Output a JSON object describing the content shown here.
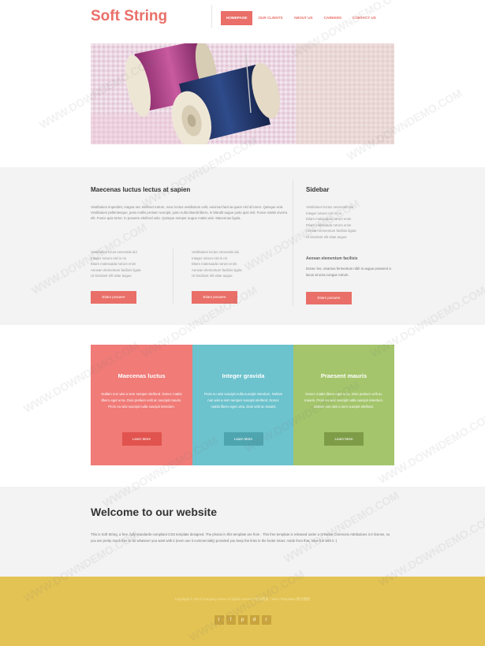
{
  "site": {
    "logo": "Soft String",
    "nav": [
      "HOMEPAGE",
      "OUR CLIENTS",
      "ABOUT US",
      "CAREERS",
      "CONTACT US"
    ]
  },
  "main": {
    "title": "Maecenas luctus lectus at sapien",
    "paragraph": "Vestibulum imperdiet, magna nec eleifend rutrum, nunc lectus vestibulum velit, euismod lacinia quam nisl id lorem. Quisque erat. Vestibulum pellentesque, justo mollis pretium suscipit, justo nulla blandit libero, in blandit augue justo quis nisl. Fusce mattis viverra elit. Fusce quis tortor. In posuere eleifend odio. Quisque semper augue mattis wisi. Maecenas ligula.",
    "col1": [
      "Vestibulum lucus venenatis dui",
      "Integer rutrum nisl in mi",
      "Etiam malesuada rutrum enim",
      "Aenean elementum facilisis ligula",
      "Ut tincidunt elit vitae augue"
    ],
    "col2": [
      "Vestibulum luctus venenatis dui",
      "Integer rutrum nisl in mi",
      "Etiam malesuada rutrum enim",
      "Aenean elementum facilisis ligula",
      "Ut tincidunt elit vitae augue"
    ],
    "button1": "Etiam posuere",
    "button2": "Etiam posuere"
  },
  "sidebar": {
    "title": "Sidebar",
    "list": [
      "Vestibulum luctus venenatis dui",
      "Integer rutrum nisl in mi",
      "Etiam malesuada rutrum enim",
      "Etiam malesuada rutrum enim",
      "Aenean elementum facilisis ligula",
      "Ut tincidunt elit vitae augue"
    ],
    "subtitle": "Aenean elementum facilisis",
    "text": "Donec leo, vivamus fermentum nibh in augue praesent a lacus at urna congue rutrum.",
    "button": "Etiam posuere"
  },
  "boxes": [
    {
      "title": "Maecenas luctus",
      "text": "Nullam non wisi a sem semper eleifend. Donec mattis libero eget urna. Duis pretium velit ac suscipit mauris. Proin eu wisi suscipit nulla suscipit interdum.",
      "button": "Learn More"
    },
    {
      "title": "Integer gravida",
      "text": "Proin eu wisi suscipit nulla suscipit interdum. Nullam non wisi a sem semper suscipit eleifend. Donec mattis libero eget urna. Duis velit ac mauris",
      "button": "Learn More"
    },
    {
      "title": "Praesent mauris",
      "text": "Donec mattis libero eget urna. Duis pretium velit ac mauris. Proin eu wisi suscipit nulla suscipit interdum. Nullam non wisi a sem suscipit eleifend.",
      "button": "Learn More"
    }
  ],
  "welcome": {
    "title": "Welcome to our website",
    "text": "This is Soft String, a free, fully standards-compliant CSS template designed. The photos in this template are from . This free template is released under a Creative Commons Attributions 3.0 license, so you are pretty much free to do whatever you want with it (even use it commercially) provided you keep the links in the footer intact. Aside from that, have fun with it :)"
  },
  "footer": {
    "copyright": "Copyright © 2013 Company name All rights reserved 网页模板 · More Templates 网页模板",
    "socials": [
      "t",
      "f",
      "p",
      "d",
      "r"
    ]
  },
  "watermark": "WWW.DOWNDEMO.COM",
  "colors": {
    "accent": "#e96f68",
    "teal": "#6cc2cd",
    "green": "#a4c56b",
    "footer": "#e3c354"
  }
}
